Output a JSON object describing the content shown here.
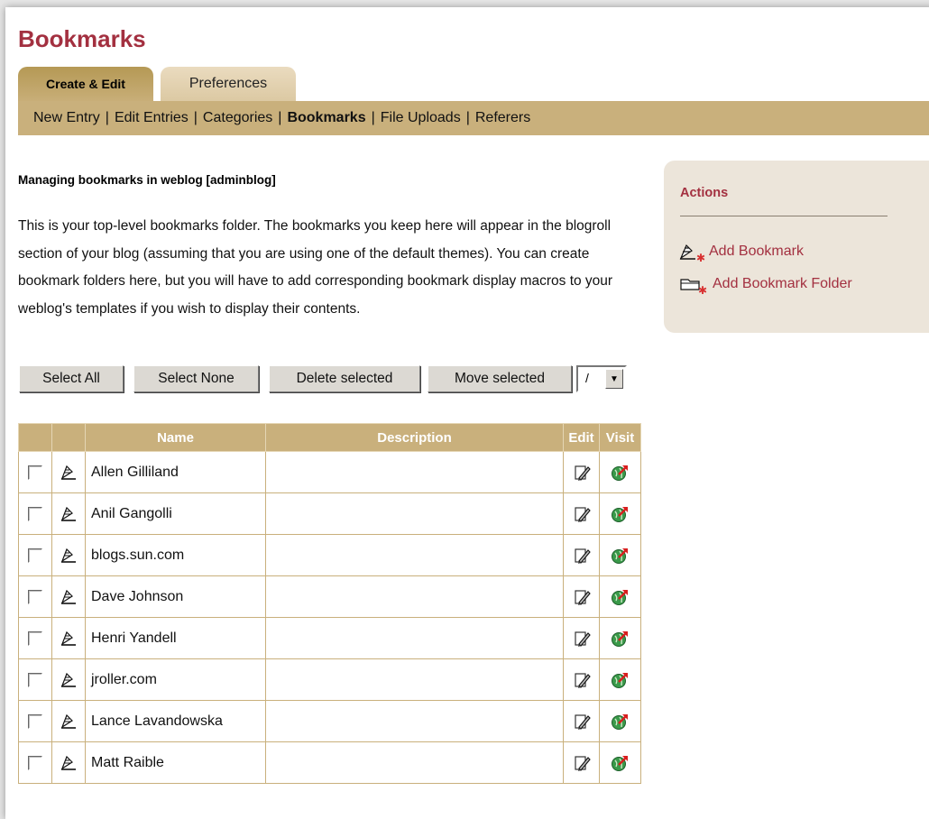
{
  "page_title": "Bookmarks",
  "tabs": [
    {
      "label": "Create & Edit",
      "active": true
    },
    {
      "label": "Preferences",
      "active": false
    }
  ],
  "subnav": {
    "items": [
      "New Entry",
      "Edit Entries",
      "Categories",
      "Bookmarks",
      "File Uploads",
      "Referers"
    ],
    "current": "Bookmarks",
    "separator": "|"
  },
  "heading": "Managing bookmarks in weblog [adminblog]",
  "intro": "This is your top-level bookmarks folder. The bookmarks you keep here will appear in the blogroll section of your blog (assuming that you are using one of the default themes). You can create bookmark folders here, but you will have to add corresponding bookmark display macros to your weblog's templates if you wish to display their contents.",
  "buttons": {
    "select_all": "Select All",
    "select_none": "Select None",
    "delete_selected": "Delete selected",
    "move_selected": "Move selected"
  },
  "folder_select": {
    "value": "/"
  },
  "table": {
    "headers": {
      "name": "Name",
      "description": "Description",
      "edit": "Edit",
      "visit": "Visit"
    },
    "rows": [
      {
        "name": "Allen Gilliland",
        "description": ""
      },
      {
        "name": "Anil Gangolli",
        "description": ""
      },
      {
        "name": "blogs.sun.com",
        "description": ""
      },
      {
        "name": "Dave Johnson",
        "description": ""
      },
      {
        "name": "Henri Yandell",
        "description": ""
      },
      {
        "name": "jroller.com",
        "description": ""
      },
      {
        "name": "Lance Lavandowska",
        "description": ""
      },
      {
        "name": "Matt Raible",
        "description": ""
      }
    ]
  },
  "actions": {
    "title": "Actions",
    "add_bookmark": "Add Bookmark",
    "add_bookmark_folder": "Add Bookmark Folder"
  },
  "icons": {
    "bookmark": "bookmark-icon",
    "edit": "edit-icon",
    "visit": "visit-icon",
    "add_bookmark": "add-bookmark-icon",
    "add_folder": "add-folder-icon"
  },
  "colors": {
    "accent": "#a33040",
    "tan": "#c9b07c",
    "sidebar_bg": "#ece5da"
  }
}
